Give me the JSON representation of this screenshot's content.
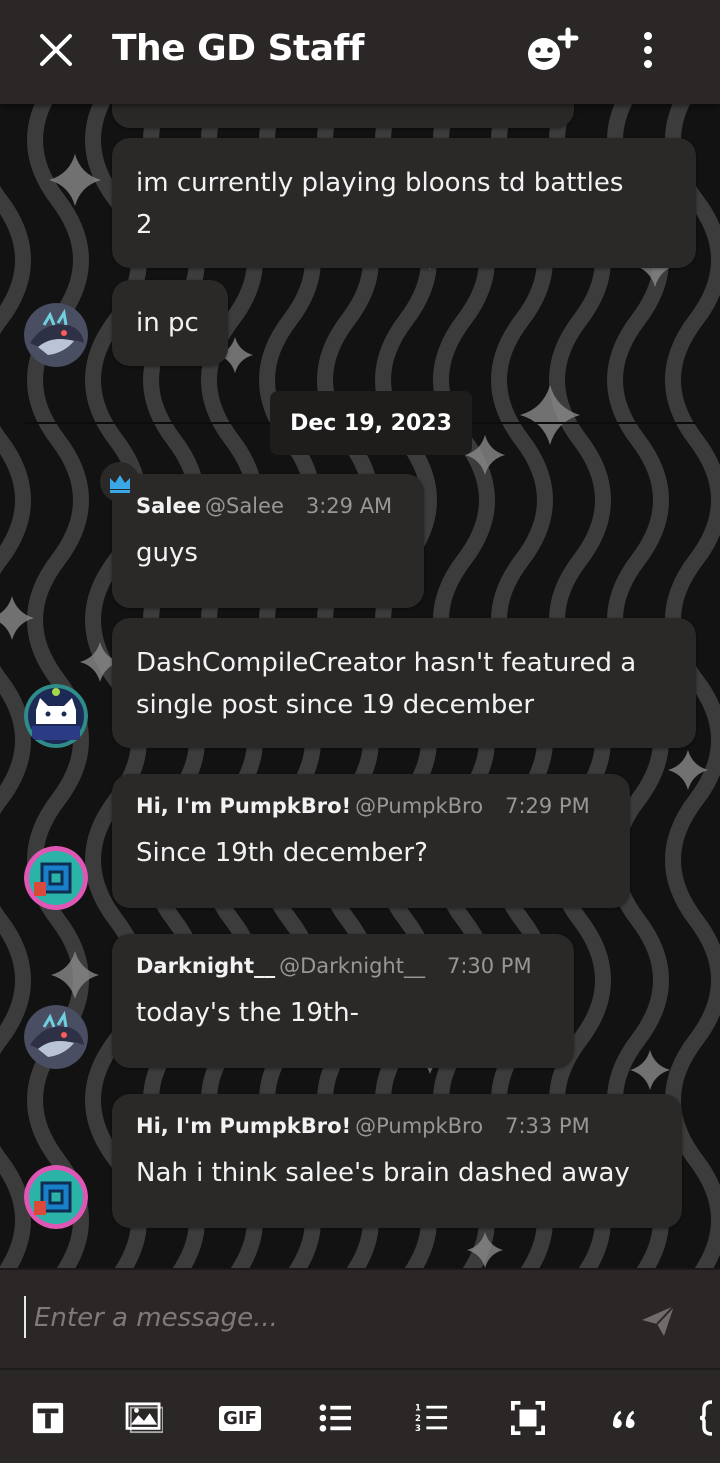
{
  "header": {
    "title": "The GD Staff"
  },
  "messages": [
    {
      "text": "im currently playing bloons td battles\n2"
    },
    {
      "text": "in pc"
    },
    {
      "author": "Salee",
      "handle": "@Salee",
      "time": "3:29 AM",
      "text": "guys"
    },
    {
      "text": "DashCompileCreator hasn't featured a\nsingle post since 19 december"
    },
    {
      "author": "Hi, I'm PumpkBro!",
      "handle": "@PumpkBro",
      "time": "7:29 PM",
      "text": "Since 19th december?"
    },
    {
      "author": "Darknight__",
      "handle": "@Darknight__",
      "time": "7:30 PM",
      "text": "today's the 19th-"
    },
    {
      "author": "Hi, I'm PumpkBro!",
      "handle": "@PumpkBro",
      "time": "7:33 PM",
      "text": "Nah i think salee's brain dashed away"
    }
  ],
  "date_divider": "Dec 19, 2023",
  "composer": {
    "placeholder": "Enter a message..."
  },
  "toolbar": {
    "items": [
      "title-block-icon",
      "image-icon",
      "gif-icon",
      "bullet-list-icon",
      "numbered-list-icon",
      "crop-icon",
      "quote-icon",
      "code-icon"
    ],
    "gif_label": "GIF"
  },
  "colors": {
    "header_bg": "#2a2726",
    "bubble_bg": "#2b2928",
    "page_bg": "#141414",
    "muted_text": "#9a9693",
    "accent_blue": "#3aa7e6"
  }
}
